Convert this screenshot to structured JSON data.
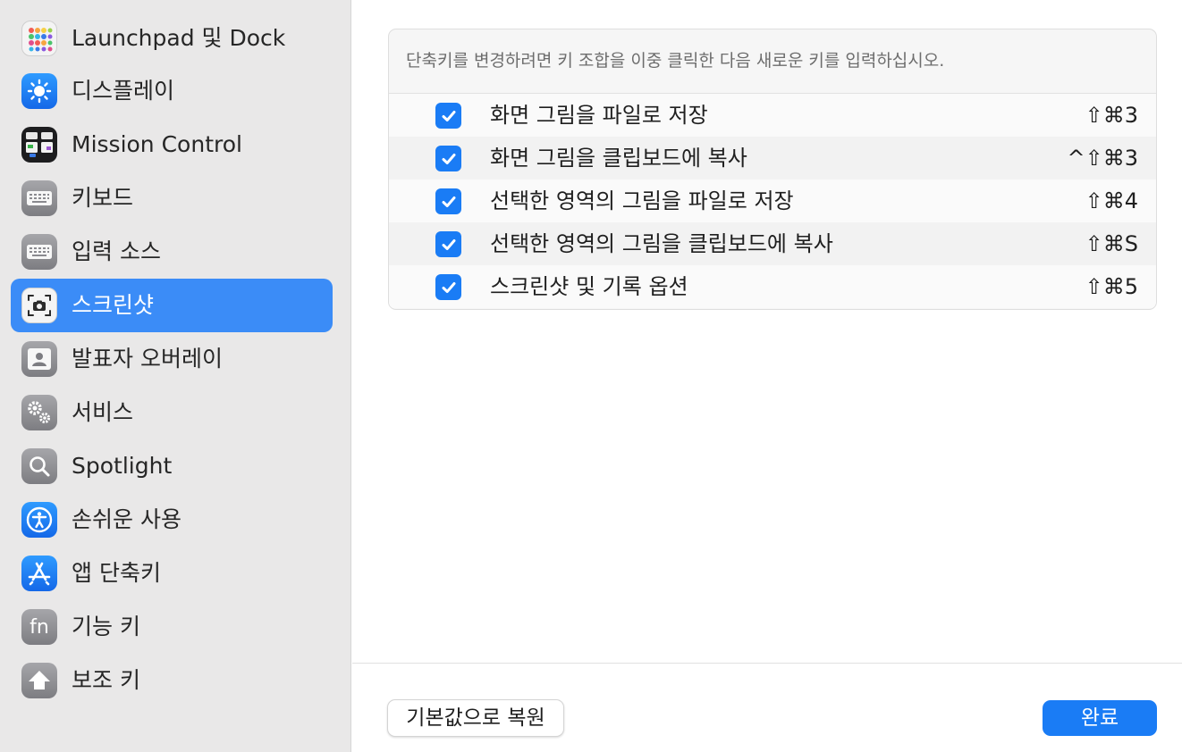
{
  "sidebar": {
    "items": [
      {
        "label": "Launchpad 및 Dock",
        "icon": "launchpad-icon"
      },
      {
        "label": "디스플레이",
        "icon": "display-brightness-icon"
      },
      {
        "label": "Mission Control",
        "icon": "mission-control-icon"
      },
      {
        "label": "키보드",
        "icon": "keyboard-icon"
      },
      {
        "label": "입력 소스",
        "icon": "input-sources-keyboard-icon"
      },
      {
        "label": "스크린샷",
        "icon": "screenshot-camera-icon",
        "selected": true
      },
      {
        "label": "발표자 오버레이",
        "icon": "presenter-overlay-icon"
      },
      {
        "label": "서비스",
        "icon": "services-gears-icon"
      },
      {
        "label": "Spotlight",
        "icon": "spotlight-magnifier-icon"
      },
      {
        "label": "손쉬운 사용",
        "icon": "accessibility-icon"
      },
      {
        "label": "앱 단축키",
        "icon": "app-store-icon"
      },
      {
        "label": "기능 키",
        "icon": "fn-key-icon"
      },
      {
        "label": "보조 키",
        "icon": "modifier-keys-arrow-icon"
      }
    ]
  },
  "main": {
    "hint": "단축키를 변경하려면 키 조합을 이중 클릭한 다음 새로운 키를 입력하십시오.",
    "shortcuts": [
      {
        "label": "화면 그림을 파일로 저장",
        "keys": "⇧⌘3",
        "checked": true
      },
      {
        "label": "화면 그림을 클립보드에 복사",
        "keys": "^⇧⌘3",
        "checked": true
      },
      {
        "label": "선택한 영역의 그림을 파일로 저장",
        "keys": "⇧⌘4",
        "checked": true
      },
      {
        "label": "선택한 영역의 그림을 클립보드에 복사",
        "keys": "⇧⌘S",
        "checked": true
      },
      {
        "label": "스크린샷 및 기록 옵션",
        "keys": "⇧⌘5",
        "checked": true
      }
    ]
  },
  "footer": {
    "restore_label": "기본값으로 복원",
    "done_label": "완료"
  },
  "colors": {
    "accent": "#1a7cf5",
    "selected_sidebar": "#3b8cf7",
    "sidebar_bg": "#e9e8e8"
  }
}
